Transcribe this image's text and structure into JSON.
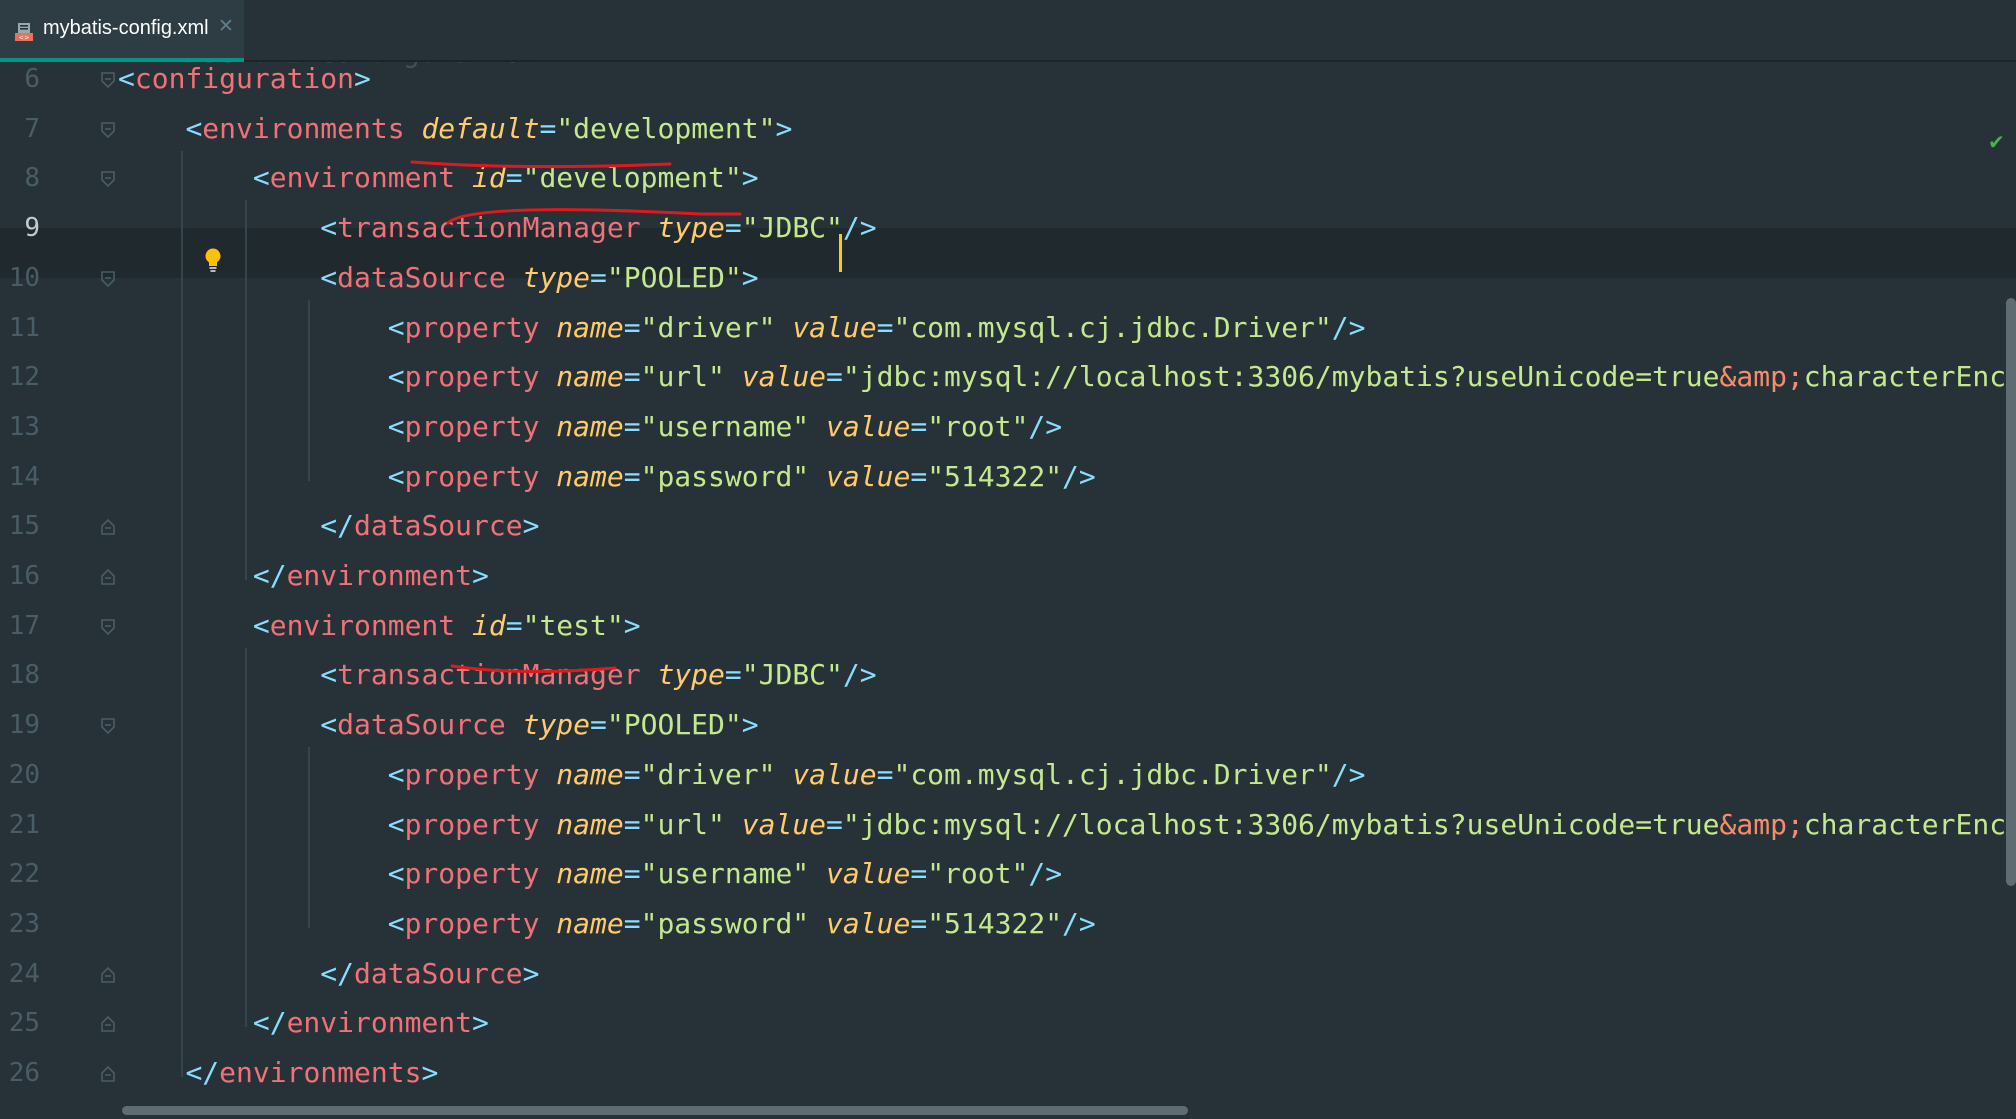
{
  "tab": {
    "file_name": "mybatis-config.xml",
    "icon": "xml-file-icon",
    "close_icon": "close-icon"
  },
  "colors": {
    "bracket": "#89ddff",
    "tag": "#f07178",
    "attribute": "#ffcb6b",
    "value": "#c3e88d",
    "entity": "#f78c6c",
    "line_number": "#4a5c66",
    "background": "#263238",
    "caret": "#ffcc00",
    "annotation": "#e0191e"
  },
  "editor": {
    "lines": [
      {
        "num": "6",
        "code": "<configuration>"
      },
      {
        "num": "7",
        "code": "    <environments default=\"development\">"
      },
      {
        "num": "8",
        "code": "        <environment id=\"development\">"
      },
      {
        "num": "9",
        "code": "            <transactionManager type=\"JDBC\"/>"
      },
      {
        "num": "10",
        "code": "            <dataSource type=\"POOLED\">"
      },
      {
        "num": "11",
        "code": "                <property name=\"driver\" value=\"com.mysql.cj.jdbc.Driver\"/>"
      },
      {
        "num": "12",
        "code": "                <property name=\"url\" value=\"jdbc:mysql://localhost:3306/mybatis?useUnicode=true&amp;characterEncoding="
      },
      {
        "num": "13",
        "code": "                <property name=\"username\" value=\"root\"/>"
      },
      {
        "num": "14",
        "code": "                <property name=\"password\" value=\"514322\"/>"
      },
      {
        "num": "15",
        "code": "            </dataSource>"
      },
      {
        "num": "16",
        "code": "        </environment>"
      },
      {
        "num": "17",
        "code": "        <environment id=\"test\">"
      },
      {
        "num": "18",
        "code": "            <transactionManager type=\"JDBC\"/>"
      },
      {
        "num": "19",
        "code": "            <dataSource type=\"POOLED\">"
      },
      {
        "num": "20",
        "code": "                <property name=\"driver\" value=\"com.mysql.cj.jdbc.Driver\"/>"
      },
      {
        "num": "21",
        "code": "                <property name=\"url\" value=\"jdbc:mysql://localhost:3306/mybatis?useUnicode=true&amp;characterEncoding=u"
      },
      {
        "num": "22",
        "code": "                <property name=\"username\" value=\"root\"/>"
      },
      {
        "num": "23",
        "code": "                <property name=\"password\" value=\"514322\"/>"
      },
      {
        "num": "24",
        "code": "            </dataSource>"
      },
      {
        "num": "25",
        "code": "        </environment>"
      },
      {
        "num": "26",
        "code": "    </environments>"
      }
    ],
    "current_line": "9",
    "intention_icon": "lightbulb-icon",
    "status_icon": "checkmark-icon"
  }
}
